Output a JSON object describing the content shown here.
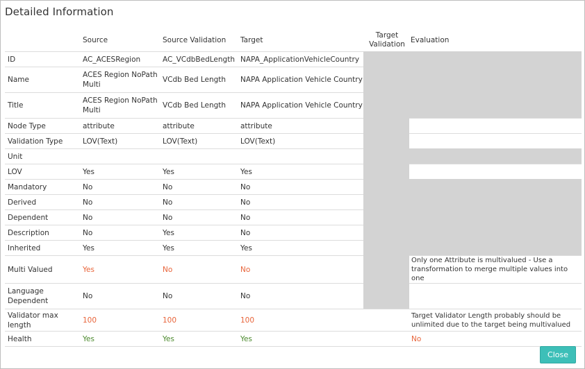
{
  "dialog": {
    "title": "Detailed Information",
    "close_label": "Close"
  },
  "columns": [
    "",
    "Source",
    "Source Validation",
    "Target",
    "Target Validation",
    "Evaluation"
  ],
  "rows": [
    {
      "label": "ID",
      "source": "AC_ACESRegion",
      "source_validation": "AC_VCdbBedLength",
      "target": "NAPA_ApplicationVehicleCountry",
      "evaluation": ""
    },
    {
      "label": "Name",
      "source": "ACES Region NoPath Multi",
      "source_validation": "VCdb Bed Length",
      "target": "NAPA Application Vehicle Country",
      "evaluation": ""
    },
    {
      "label": "Title",
      "source": "ACES Region NoPath Multi",
      "source_validation": "VCdb Bed Length",
      "target": "NAPA Application Vehicle Country",
      "evaluation": ""
    },
    {
      "label": "Node Type",
      "source": "attribute",
      "source_validation": "attribute",
      "target": "attribute",
      "evaluation": ""
    },
    {
      "label": "Validation Type",
      "source": "LOV(Text)",
      "source_validation": "LOV(Text)",
      "target": "LOV(Text)",
      "evaluation": ""
    },
    {
      "label": "Unit",
      "source": "",
      "source_validation": "",
      "target": "",
      "evaluation": ""
    },
    {
      "label": "LOV",
      "source": "Yes",
      "source_validation": "Yes",
      "target": "Yes",
      "evaluation": ""
    },
    {
      "label": "Mandatory",
      "source": "No",
      "source_validation": "No",
      "target": "No",
      "evaluation": ""
    },
    {
      "label": "Derived",
      "source": "No",
      "source_validation": "No",
      "target": "No",
      "evaluation": ""
    },
    {
      "label": "Dependent",
      "source": "No",
      "source_validation": "No",
      "target": "No",
      "evaluation": ""
    },
    {
      "label": "Description",
      "source": "No",
      "source_validation": "Yes",
      "target": "No",
      "evaluation": ""
    },
    {
      "label": "Inherited",
      "source": "Yes",
      "source_validation": "Yes",
      "target": "Yes",
      "evaluation": ""
    },
    {
      "label": "Multi Valued",
      "source": "Yes",
      "source_validation": "No",
      "target": "No",
      "evaluation": "Only one Attribute is multivalued - Use a transformation to merge multiple values into one"
    },
    {
      "label": "Language Dependent",
      "source": "No",
      "source_validation": "No",
      "target": "No",
      "evaluation": ""
    },
    {
      "label": "Validator max length",
      "source": "100",
      "source_validation": "100",
      "target": "100",
      "evaluation": "Target Validator Length probably should be unlimited due to the target being multivalued"
    },
    {
      "label": "Health",
      "source": "Yes",
      "source_validation": "Yes",
      "target": "Yes",
      "evaluation": "No"
    }
  ],
  "colors": {
    "accent": "#3dbfb8",
    "warning": "#e8643a",
    "ok": "#4c8a2e",
    "disabled_cell": "#d3d3d3"
  }
}
